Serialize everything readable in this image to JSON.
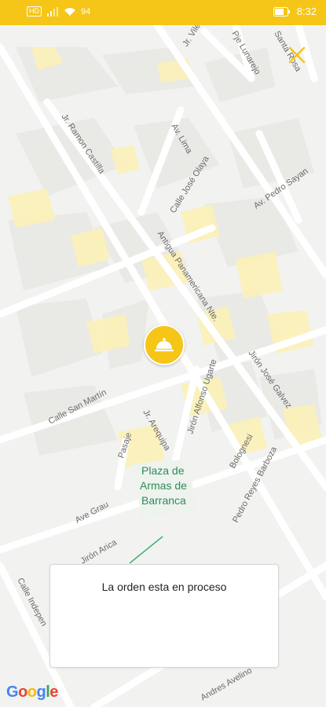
{
  "status_bar": {
    "left_badge": "HD",
    "network": "94",
    "time": "8:32"
  },
  "map": {
    "streets": [
      "Jr. Vilela",
      "Pje Lunarejo",
      "Santa Rosa",
      "Jr. Ramon Castilla",
      "Av. Lima",
      "Calle José Olaya",
      "Av. Pedro Sayan",
      "Antigua Panamericana Nte.",
      "Jirón Alfonso Ugarte",
      "Jirón José Galvez",
      "Calle San Martín",
      "Jr. Arequipa",
      "Pasaje",
      "Bolognesi",
      "Pedro Reyes Barboza",
      "Ave Grau",
      "Jirón Arica",
      "Calle Indepen",
      "Andres Avelino"
    ],
    "plaza": {
      "line1": "Plaza de",
      "line2": "Armas de",
      "line3": "Barranca"
    },
    "marker_icon": "food-cloche-icon",
    "colors": {
      "accent": "#f5c518",
      "map_background": "#f2f2f0",
      "block_yellow": "#fbf1b8",
      "plaza_green": "#2e8b57"
    }
  },
  "info_card": {
    "message": "La orden esta en proceso"
  },
  "footer": {
    "logo_text": "Google"
  }
}
